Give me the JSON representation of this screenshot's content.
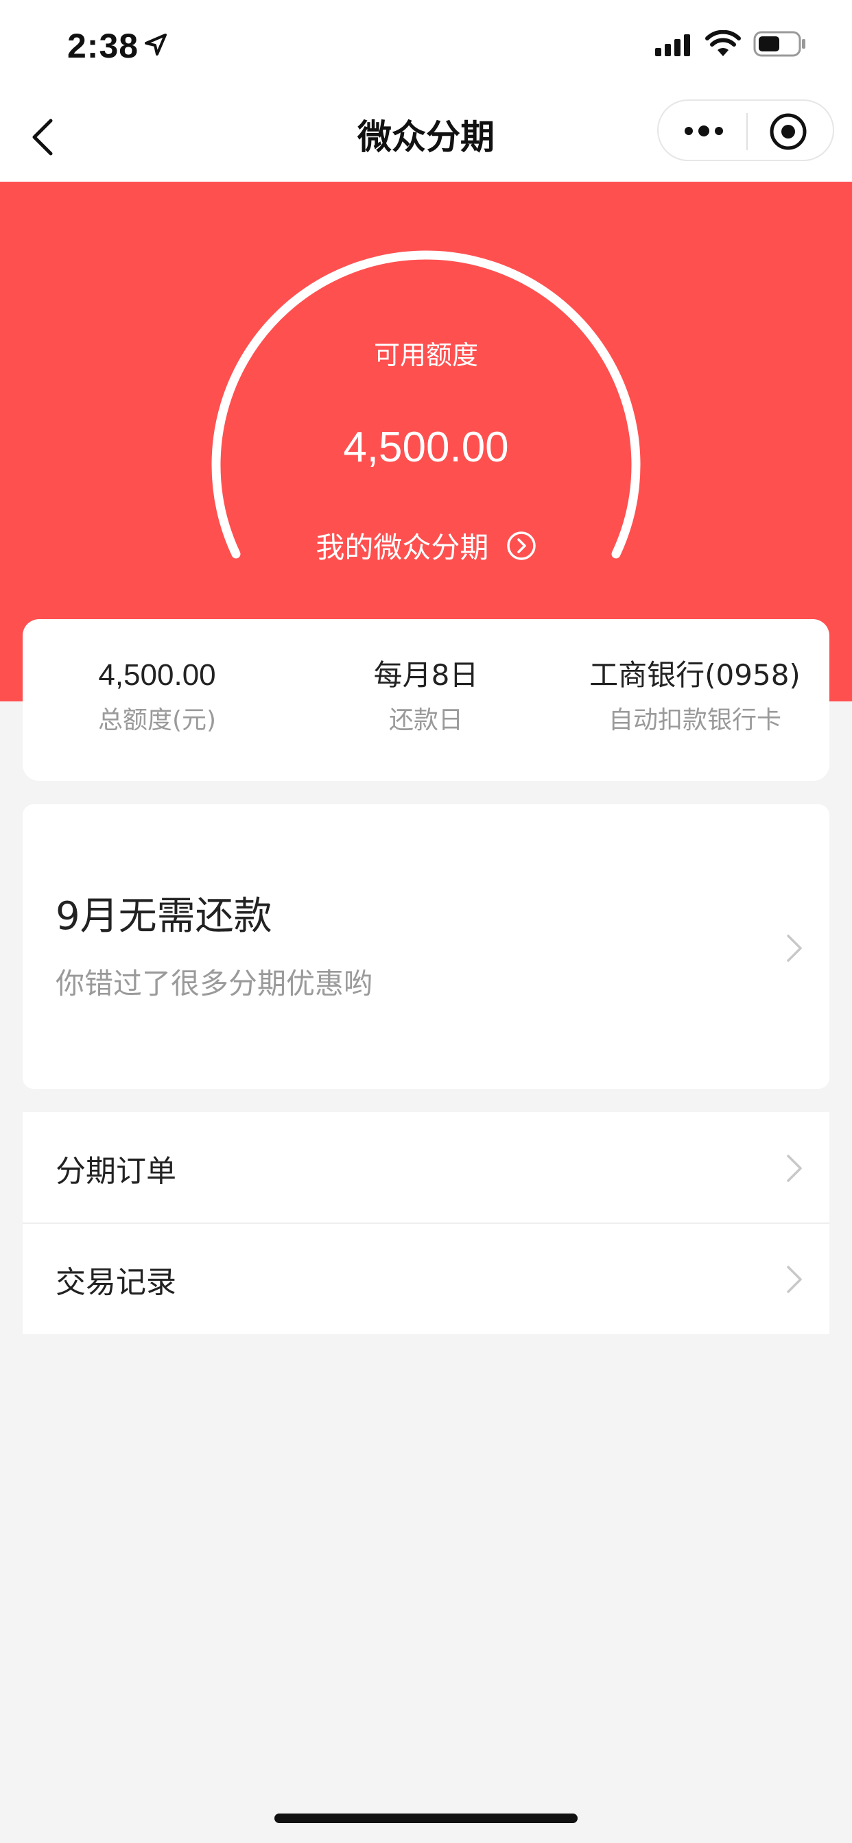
{
  "status_bar": {
    "time": "2:38",
    "icons": [
      "location-arrow-icon",
      "signal-icon",
      "wifi-icon",
      "battery-icon"
    ]
  },
  "nav": {
    "title": "微众分期",
    "back_icon": "chevron-left-icon",
    "more_icon": "more-dots-icon",
    "close_icon": "target-circle-icon"
  },
  "hero": {
    "background_color": "#ff5050",
    "available_label": "可用额度",
    "available_amount": "4,500.00",
    "link_label": "我的微众分期",
    "link_icon": "circle-chevron-right-icon"
  },
  "summary": {
    "items": [
      {
        "value": "4,500.00",
        "label": "总额度(元)"
      },
      {
        "value": "每月8日",
        "label": "还款日"
      },
      {
        "value": "工商银行(0958)",
        "label": "自动扣款银行卡"
      }
    ]
  },
  "notice": {
    "title": "9月无需还款",
    "subtitle": "你错过了很多分期优惠哟",
    "icon": "chevron-right-icon"
  },
  "menu": {
    "items": [
      {
        "label": "分期订单",
        "icon": "chevron-right-icon"
      },
      {
        "label": "交易记录",
        "icon": "chevron-right-icon"
      }
    ]
  }
}
